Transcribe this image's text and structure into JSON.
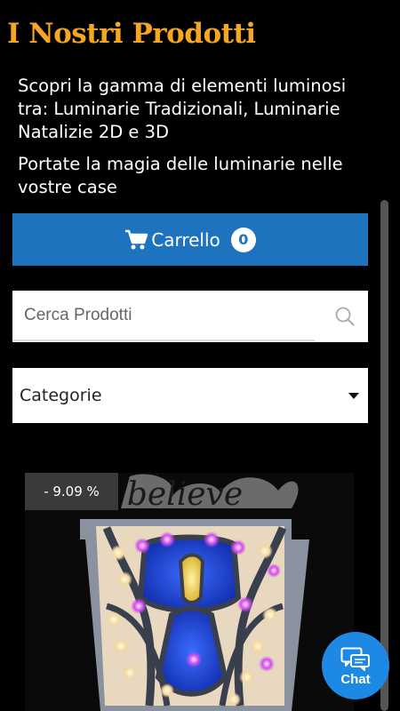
{
  "header": {
    "title": "I Nostri Prodotti",
    "description1": "Scopri la gamma di elementi luminosi tra: Luminarie Tradizionali, Luminarie Natalizie 2D e 3D",
    "description2": "Portate la magia delle luminarie nelle vostre case"
  },
  "cart": {
    "label": "Carrello",
    "count": "0"
  },
  "search": {
    "placeholder": "Cerca Prodotti",
    "value": ""
  },
  "category_select": {
    "label": "Categorie"
  },
  "product": {
    "discount": "- 9.09 %",
    "image_text": "believe"
  },
  "chat": {
    "label": "Chat"
  },
  "colors": {
    "accent": "#f5a623",
    "primary": "#1e73be",
    "chat": "#1e88e5"
  }
}
